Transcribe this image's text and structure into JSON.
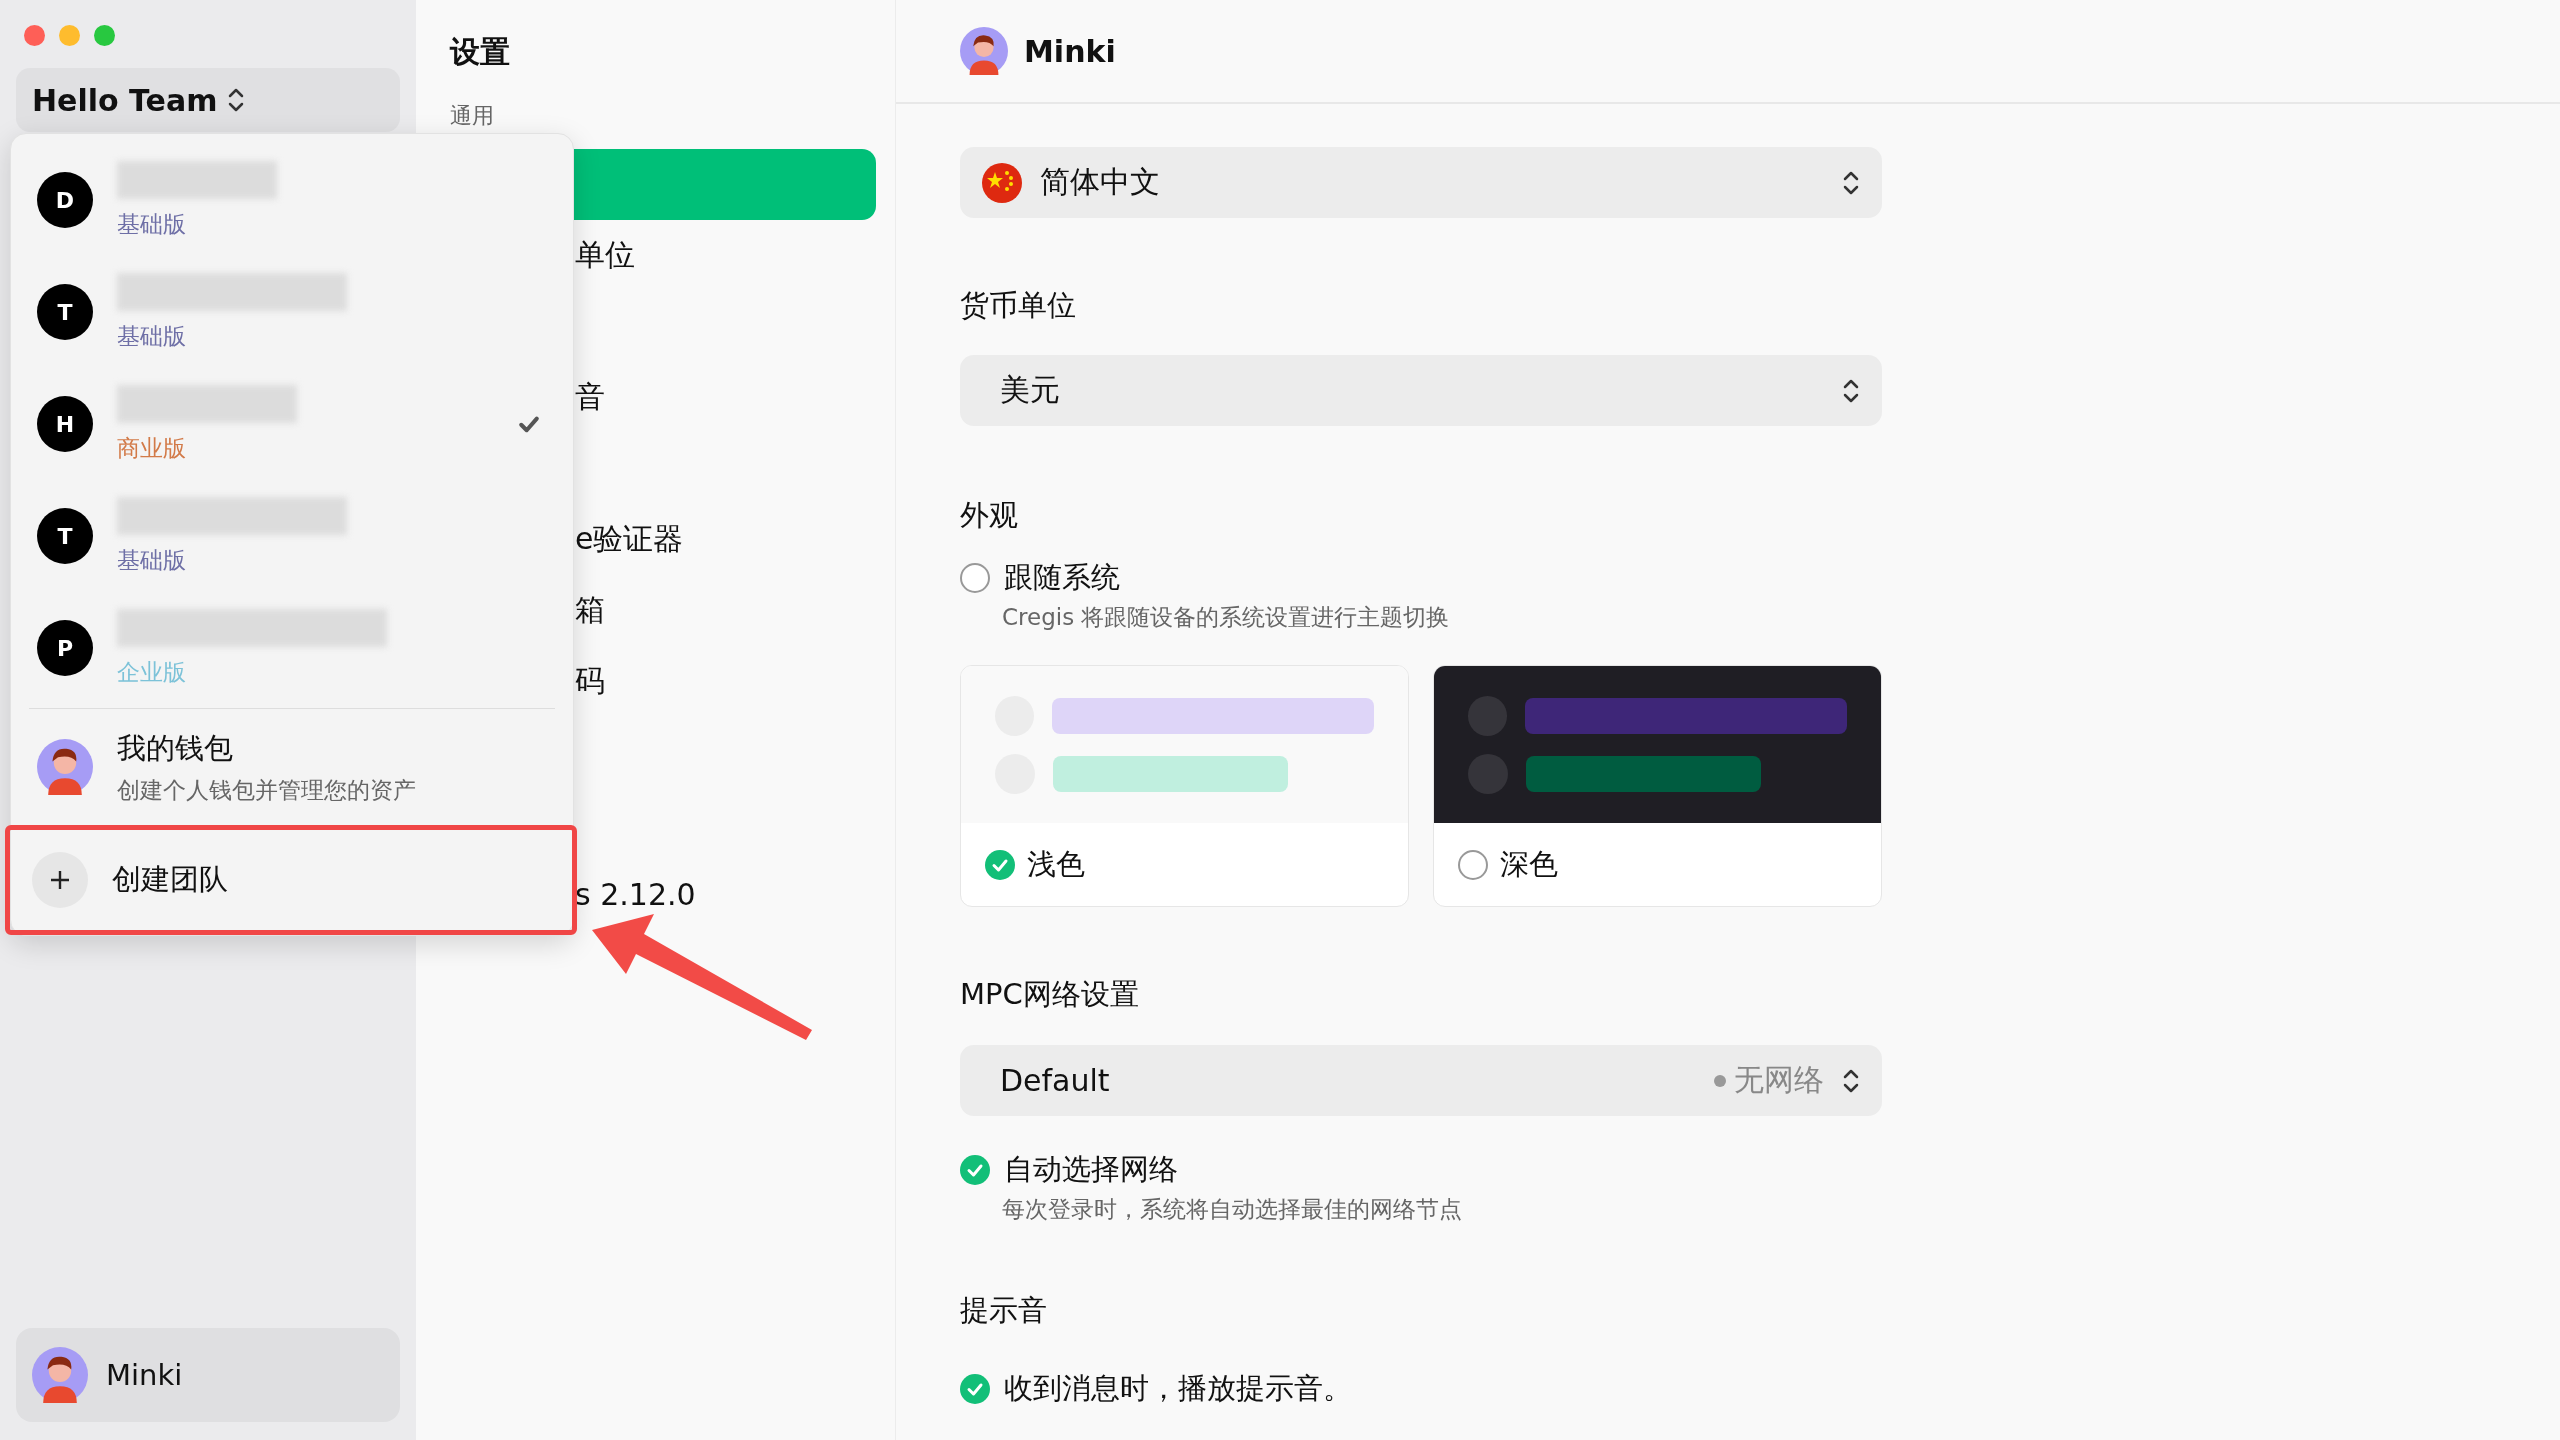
{
  "sidebar": {
    "team_switcher": {
      "label": "Hello Team"
    },
    "user": {
      "name": "Minki"
    }
  },
  "team_menu": {
    "teams": [
      {
        "initial": "D",
        "plan": "基础版",
        "color": "#6e6fa6",
        "selected": false
      },
      {
        "initial": "T",
        "plan": "基础版",
        "color": "#6e6fa6",
        "selected": false
      },
      {
        "initial": "H",
        "plan": "商业版",
        "color": "#d27a48",
        "selected": true
      },
      {
        "initial": "T",
        "plan": "基础版",
        "color": "#6e6fa6",
        "selected": false
      },
      {
        "initial": "P",
        "plan": "企业版",
        "color": "#7cc2d8",
        "selected": false
      }
    ],
    "wallet": {
      "title": "我的钱包",
      "subtitle": "创建个人钱包并管理您的资产"
    },
    "create": {
      "label": "创建团队",
      "highlighted": true
    }
  },
  "annotation": {
    "kind": "arrow"
  },
  "settings_nav": {
    "title": "设置",
    "section": "通用",
    "items": [
      {
        "selected": true
      },
      {
        "label": "单位",
        "selected": false
      },
      {
        "label": "音",
        "selected": false
      },
      {
        "label": "e验证器",
        "selected": false
      },
      {
        "label": "箱",
        "selected": false
      },
      {
        "label": "码",
        "selected": false
      },
      {
        "label": "s 2.12.0",
        "selected": false
      }
    ]
  },
  "profile": {
    "name": "Minki"
  },
  "language": {
    "value": "简体中文"
  },
  "currency": {
    "label": "货币单位",
    "value": "美元"
  },
  "appearance": {
    "label": "外观",
    "follow_system": {
      "label": "跟随系统",
      "description": "Cregis 将跟随设备的系统设置进行主题切换",
      "checked": false
    },
    "themes": [
      {
        "kind": "light",
        "label": "浅色",
        "selected": true
      },
      {
        "kind": "dark",
        "label": "深色",
        "selected": false
      }
    ]
  },
  "network": {
    "label": "MPC网络设置",
    "value": "Default",
    "status": "无网络",
    "auto": {
      "label": "自动选择网络",
      "description": "每次登录时，系统将自动选择最佳的网络节点",
      "checked": true
    }
  },
  "sound": {
    "label": "提示音",
    "option": {
      "label": "收到消息时，播放提示音。",
      "checked": true
    }
  }
}
